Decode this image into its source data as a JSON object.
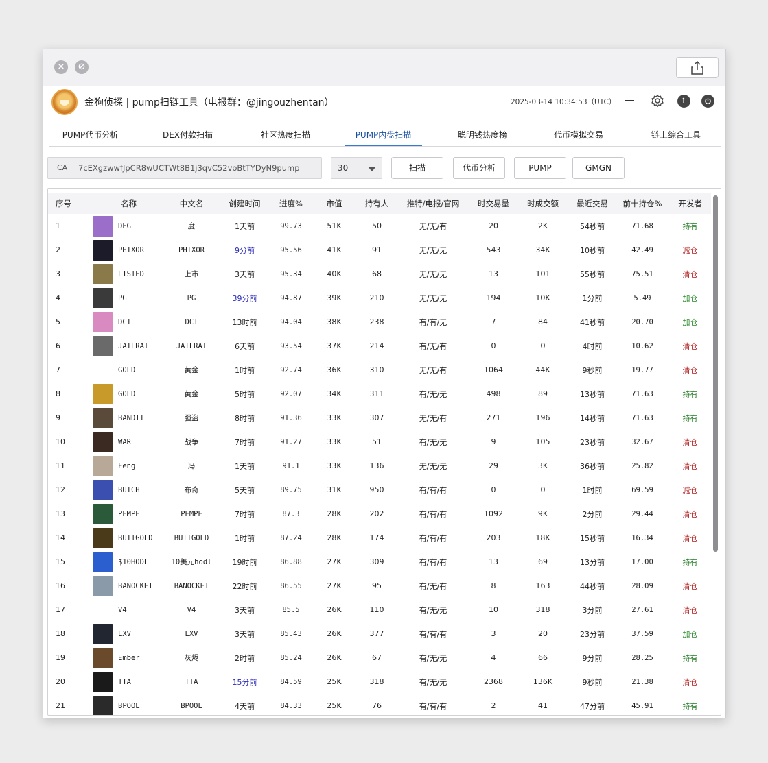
{
  "app": {
    "title": "金狗侦探 | pump扫链工具（电报群：@jingouzhentan）",
    "datetime": "2025-03-14 10:34:53（UTC）"
  },
  "tabs": [
    {
      "label": "PUMP代币分析"
    },
    {
      "label": "DEX付款扫描"
    },
    {
      "label": "社区热度扫描"
    },
    {
      "label": "PUMP内盘扫描"
    },
    {
      "label": "聪明钱热度榜"
    },
    {
      "label": "代币模拟交易"
    },
    {
      "label": "链上综合工具"
    }
  ],
  "active_tab": "PUMP内盘扫描",
  "toolbar": {
    "ca_label": "CA",
    "ca_value": "7cEXgzwwfJpCR8wUCTWt8B1j3qvC52voBtTYDyN9pump",
    "select_value": "30",
    "scan": "扫描",
    "analyze": "代币分析",
    "pump": "PUMP",
    "gmgn": "GMGN"
  },
  "table": {
    "headers": [
      "序号",
      "名称",
      "中文名",
      "创建时间",
      "进度%",
      "市值",
      "持有人",
      "推特/电报/官网",
      "时交易量",
      "时成交额",
      "最近交易",
      "前十持仓%",
      "开发者"
    ],
    "rows": [
      [
        "1",
        "DEG",
        "度",
        "1天前",
        "99.73",
        "51K",
        "50",
        "无/无/有",
        "20",
        "2K",
        "54秒前",
        "71.68",
        "持有"
      ],
      [
        "2",
        "PHIXOR",
        "PHIXOR",
        "9分前",
        "95.56",
        "41K",
        "91",
        "无/无/无",
        "543",
        "34K",
        "10秒前",
        "42.49",
        "减仓"
      ],
      [
        "3",
        "LISTED",
        "上市",
        "3天前",
        "95.34",
        "40K",
        "68",
        "无/无/无",
        "13",
        "101",
        "55秒前",
        "75.51",
        "清仓"
      ],
      [
        "4",
        "PG",
        "PG",
        "39分前",
        "94.87",
        "39K",
        "210",
        "无/无/无",
        "194",
        "10K",
        "1分前",
        "5.49",
        "加仓"
      ],
      [
        "5",
        "DCT",
        "DCT",
        "13时前",
        "94.04",
        "38K",
        "238",
        "有/有/无",
        "7",
        "84",
        "41秒前",
        "20.70",
        "加仓"
      ],
      [
        "6",
        "JAILRAT",
        "JAILRAT",
        "6天前",
        "93.54",
        "37K",
        "214",
        "有/无/有",
        "0",
        "0",
        "4时前",
        "10.62",
        "清仓"
      ],
      [
        "7",
        "GOLD",
        "黄金",
        "1时前",
        "92.74",
        "36K",
        "310",
        "无/无/有",
        "1064",
        "44K",
        "9秒前",
        "19.77",
        "清仓"
      ],
      [
        "8",
        "GOLD",
        "黄金",
        "5时前",
        "92.07",
        "34K",
        "311",
        "有/无/无",
        "498",
        "89",
        "13秒前",
        "71.63",
        "持有"
      ],
      [
        "9",
        "BANDIT",
        "强盗",
        "8时前",
        "91.36",
        "33K",
        "307",
        "无/无/有",
        "271",
        "196",
        "14秒前",
        "71.63",
        "持有"
      ],
      [
        "10",
        "WAR",
        "战争",
        "7时前",
        "91.27",
        "33K",
        "51",
        "有/无/无",
        "9",
        "105",
        "23秒前",
        "32.67",
        "清仓"
      ],
      [
        "11",
        "Feng",
        "冯",
        "1天前",
        "91.1",
        "33K",
        "136",
        "无/无/无",
        "29",
        "3K",
        "36秒前",
        "25.82",
        "清仓"
      ],
      [
        "12",
        "BUTCH",
        "布奇",
        "5天前",
        "89.75",
        "31K",
        "950",
        "有/有/有",
        "0",
        "0",
        "1时前",
        "69.59",
        "减仓"
      ],
      [
        "13",
        "PEMPE",
        "PEMPE",
        "7时前",
        "87.3",
        "28K",
        "202",
        "有/有/有",
        "1092",
        "9K",
        "2分前",
        "29.44",
        "清仓"
      ],
      [
        "14",
        "BUTTGOLD",
        "BUTTGOLD",
        "1时前",
        "87.24",
        "28K",
        "174",
        "有/有/有",
        "203",
        "18K",
        "15秒前",
        "16.34",
        "清仓"
      ],
      [
        "15",
        "$10HODL",
        "10美元hodl",
        "19时前",
        "86.88",
        "27K",
        "309",
        "有/有/有",
        "13",
        "69",
        "13分前",
        "17.00",
        "持有"
      ],
      [
        "16",
        "BANOCKET",
        "BANOCKET",
        "22时前",
        "86.55",
        "27K",
        "95",
        "有/无/有",
        "8",
        "163",
        "44秒前",
        "28.09",
        "清仓"
      ],
      [
        "17",
        "V4",
        "V4",
        "3天前",
        "85.5",
        "26K",
        "110",
        "有/无/无",
        "10",
        "318",
        "3分前",
        "27.61",
        "清仓"
      ],
      [
        "18",
        "LXV",
        "LXV",
        "3天前",
        "85.43",
        "26K",
        "377",
        "有/有/有",
        "3",
        "20",
        "23分前",
        "37.59",
        "加仓"
      ],
      [
        "19",
        "Ember",
        "灰烬",
        "2时前",
        "85.24",
        "26K",
        "67",
        "有/无/无",
        "4",
        "66",
        "9分前",
        "28.25",
        "持有"
      ],
      [
        "20",
        "TTA",
        "TTA",
        "15分前",
        "84.59",
        "25K",
        "318",
        "有/无/无",
        "2368",
        "136K",
        "9秒前",
        "21.38",
        "清仓"
      ],
      [
        "21",
        "BPOOL",
        "BPOOL",
        "4天前",
        "84.33",
        "25K",
        "76",
        "有/有/有",
        "2",
        "41",
        "47分前",
        "45.91",
        "持有"
      ]
    ],
    "avatar_colors": [
      "#9b6fc9",
      "#1b1b2a",
      "#8a7a4a",
      "#3a3a3a",
      "#d98ac0",
      "#6a6a6a",
      "#ffffff",
      "#c89a2a",
      "#5a4a3a",
      "#3a2a22",
      "#b8a898",
      "#3b4fb0",
      "#2a5a3a",
      "#4a3a1a",
      "#2b5fd0",
      "#8a9aa8",
      "#ffffff",
      "#222630",
      "#6a4a2a",
      "#1a1a1a",
      "#2a2a2a"
    ],
    "colors": {
      "hold": "#1f7a1f",
      "reduce": "#b22020",
      "clear": "#b22020",
      "add": "#2a8a2a",
      "recent": "#2a2ab8"
    }
  }
}
